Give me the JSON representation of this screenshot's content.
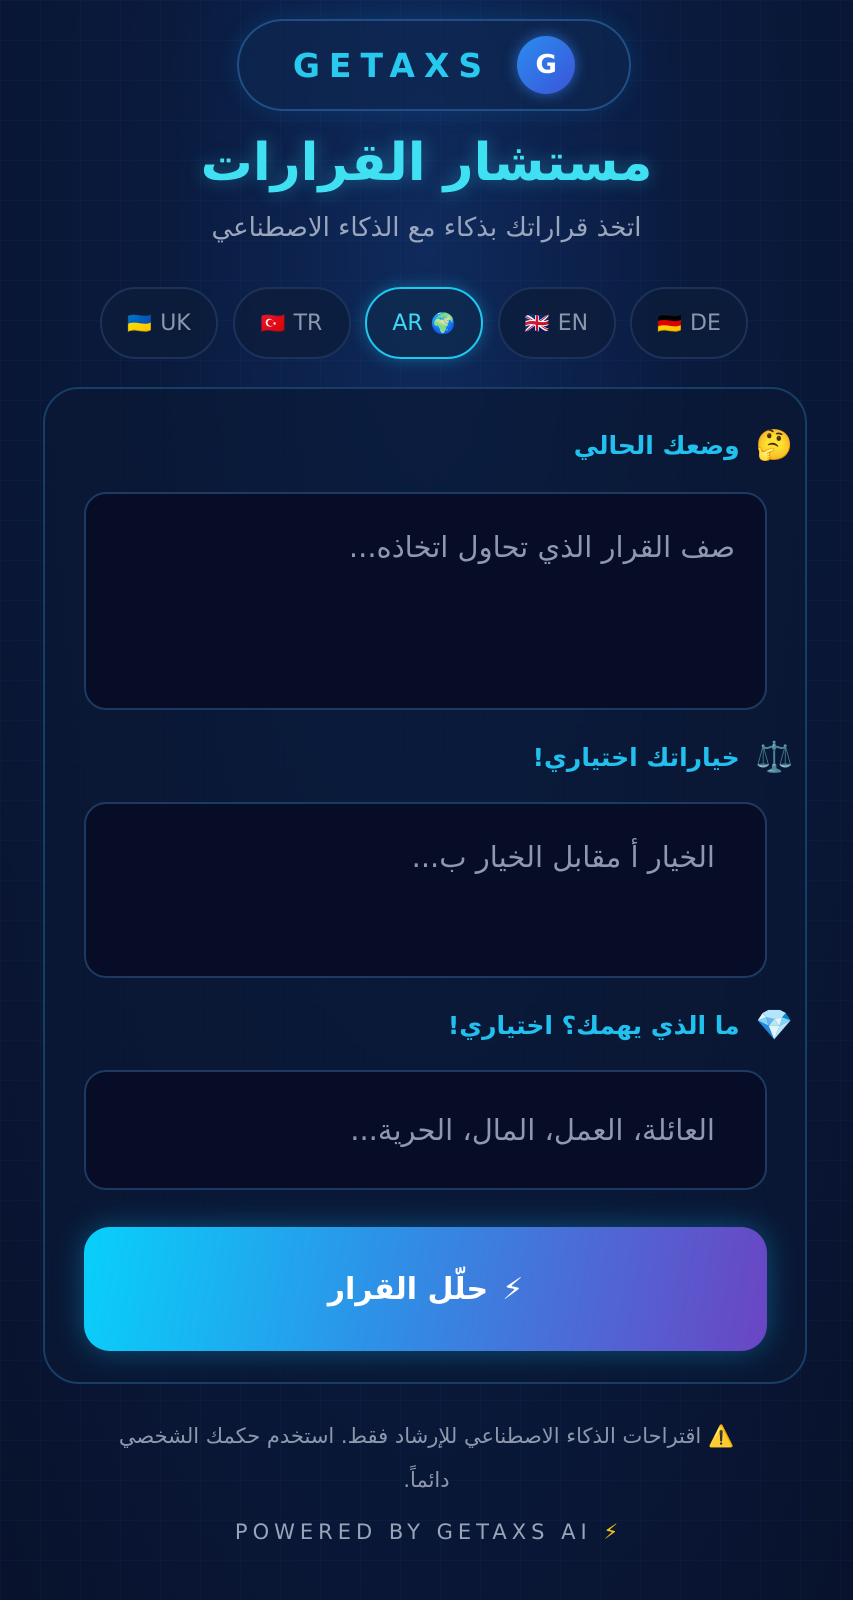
{
  "brand": {
    "name": "GETAXS",
    "logo_letter": "G"
  },
  "header": {
    "title": "مستشار القرارات",
    "subtitle": "اتخذ قراراتك بذكاء مع الذكاء الاصطناعي"
  },
  "languages": [
    {
      "flag": "🇺🇦",
      "code": "UK",
      "active": false
    },
    {
      "flag": "🇹🇷",
      "code": "TR",
      "active": false
    },
    {
      "flag": "🌍",
      "code": "AR",
      "active": true
    },
    {
      "flag": "🇬🇧",
      "code": "EN",
      "active": false
    },
    {
      "flag": "🇩🇪",
      "code": "DE",
      "active": false
    }
  ],
  "form": {
    "situation": {
      "emoji": "🤔",
      "label": "وضعك الحالي",
      "placeholder": "صف القرار الذي تحاول اتخاذه..."
    },
    "options": {
      "emoji": "⚖️",
      "label": "خياراتك اختياري!",
      "placeholder": "الخيار أ مقابل الخيار ب..."
    },
    "priorities": {
      "emoji": "💎",
      "label": "ما الذي يهمك؟ اختياري!",
      "placeholder": "العائلة، العمل، المال، الحرية..."
    },
    "submit": {
      "icon": "⚡",
      "label": "حلّل القرار"
    }
  },
  "disclaimer": {
    "icon": "⚠️",
    "text": "اقتراحات الذكاء الاصطناعي للإرشاد فقط. استخدم حكمك الشخصي دائماً."
  },
  "footer": {
    "text": "POWERED BY GETAXS AI",
    "icon": "⚡"
  },
  "colors": {
    "accent": "#22c0ee",
    "background": "#0a1a3d",
    "gradient_start": "#08d0fb",
    "gradient_end": "#6a45c4"
  }
}
